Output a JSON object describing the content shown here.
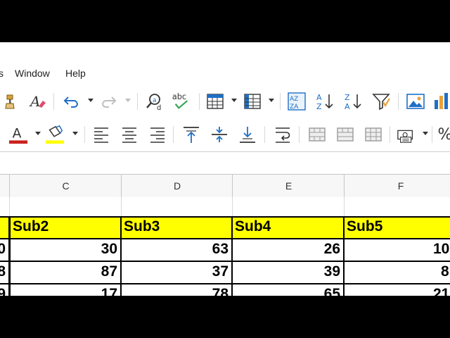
{
  "menubar": {
    "items": [
      {
        "label": "s"
      },
      {
        "label": "Window"
      },
      {
        "label": "Help"
      }
    ]
  },
  "toolbar1": {
    "icons": [
      "clone-formatting-icon",
      "clear-formatting-icon",
      "undo-icon",
      "redo-icon",
      "find-replace-icon",
      "spelling-icon",
      "row-icon",
      "column-icon",
      "sort-icon",
      "sort-ascending-icon",
      "sort-descending-icon",
      "autofilter-icon",
      "image-icon",
      "chart-icon"
    ],
    "spelling_text": "abc",
    "sort_text_top": "AZ",
    "sort_text_bottom": "ZA"
  },
  "toolbar2": {
    "icons": [
      "font-color-icon",
      "highlight-color-icon",
      "align-left-icon",
      "align-center-icon",
      "align-right-icon",
      "align-top-icon",
      "center-vertically-icon",
      "align-bottom-icon",
      "wrap-text-icon",
      "merge-cells-icon",
      "merge-center-icon",
      "unmerge-cells-icon",
      "currency-format-icon",
      "percent-format-icon"
    ],
    "font_color_letter": "A",
    "font_color": "#c9211e",
    "highlight_color": "#ffff00",
    "percent_symbol": "%"
  },
  "columns": [
    {
      "label": "C"
    },
    {
      "label": "D"
    },
    {
      "label": "E"
    },
    {
      "label": "F"
    }
  ],
  "sheet": {
    "header_row": [
      "Sub2",
      "Sub3",
      "Sub4",
      "Sub5"
    ],
    "partial_col_b_values": [
      "0",
      "8",
      "9"
    ],
    "rows": [
      [
        "30",
        "63",
        "26",
        "10"
      ],
      [
        "87",
        "37",
        "39",
        "8"
      ],
      [
        "17",
        "78",
        "65",
        "21"
      ]
    ]
  },
  "colors": {
    "header_fill": "#ffff00",
    "accent_blue": "#1f6fc5"
  }
}
